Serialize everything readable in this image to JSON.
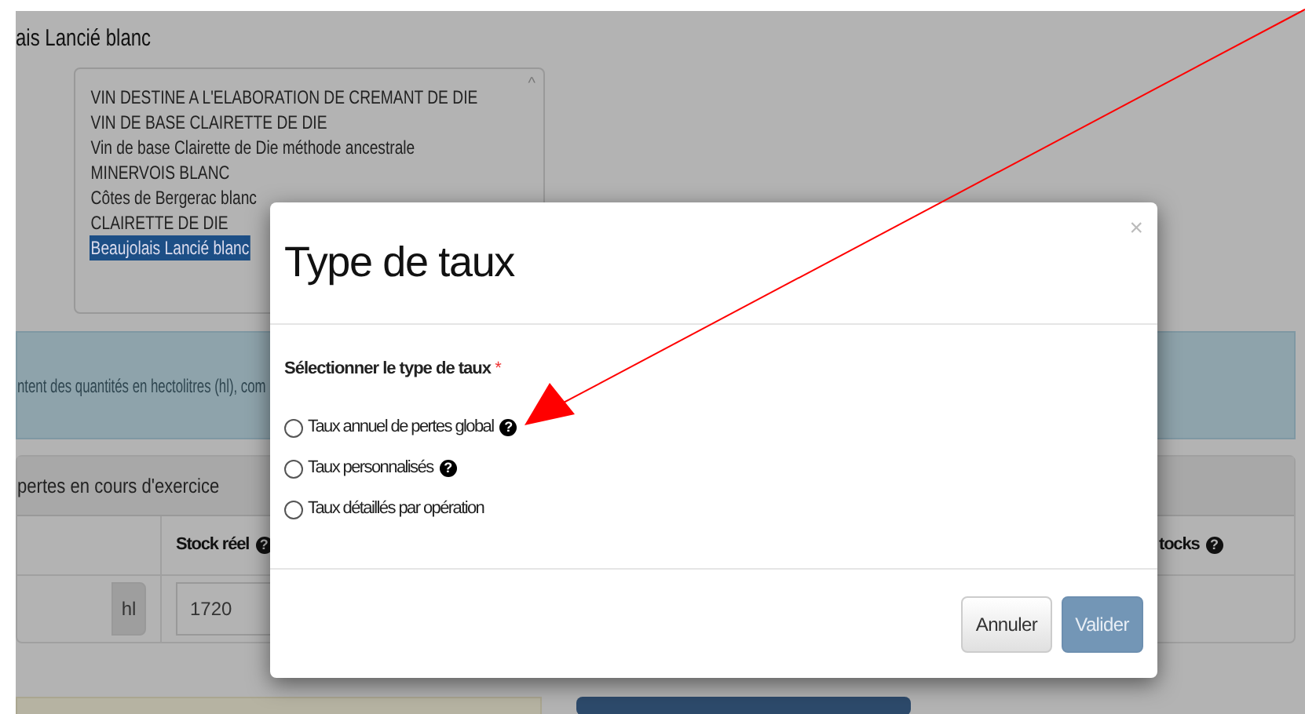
{
  "page": {
    "heading": "ais Lancié blanc",
    "listbox": {
      "scroll_glyph": "^",
      "options": [
        {
          "label": "VIN DESTINE A L'ELABORATION DE CREMANT DE DIE",
          "selected": false
        },
        {
          "label": "VIN DE BASE CLAIRETTE DE DIE",
          "selected": false
        },
        {
          "label": "Vin de base Clairette de Die méthode ancestrale",
          "selected": false
        },
        {
          "label": "MINERVOIS BLANC",
          "selected": false
        },
        {
          "label": "Côtes de Bergerac blanc",
          "selected": false
        },
        {
          "label": "CLAIRETTE DE DIE",
          "selected": false
        },
        {
          "label": "Beaujolais Lancié blanc",
          "selected": true
        }
      ]
    },
    "info_text": "ntent des quantités en hectolitres (hl), com",
    "panel": {
      "title": "pertes en cours d'exercice",
      "columns": [
        {
          "label": "Stock réel",
          "help": "?"
        },
        {
          "label": "tocks",
          "help": "?"
        }
      ],
      "row": {
        "addon": "hl",
        "stock": "1720"
      }
    }
  },
  "modal": {
    "title": "Type de taux",
    "close": "×",
    "question": "Sélectionner le type de taux",
    "required_mark": "*",
    "options": [
      {
        "label": "Taux annuel de pertes global",
        "help": "?",
        "selected": false
      },
      {
        "label": "Taux personnalisés",
        "help": "?",
        "selected": false
      },
      {
        "label": "Taux détaillés par opération",
        "selected": false
      }
    ],
    "buttons": [
      {
        "label": "Annuler",
        "kind": "secondary"
      },
      {
        "label": "Valider",
        "kind": "primary"
      }
    ]
  }
}
